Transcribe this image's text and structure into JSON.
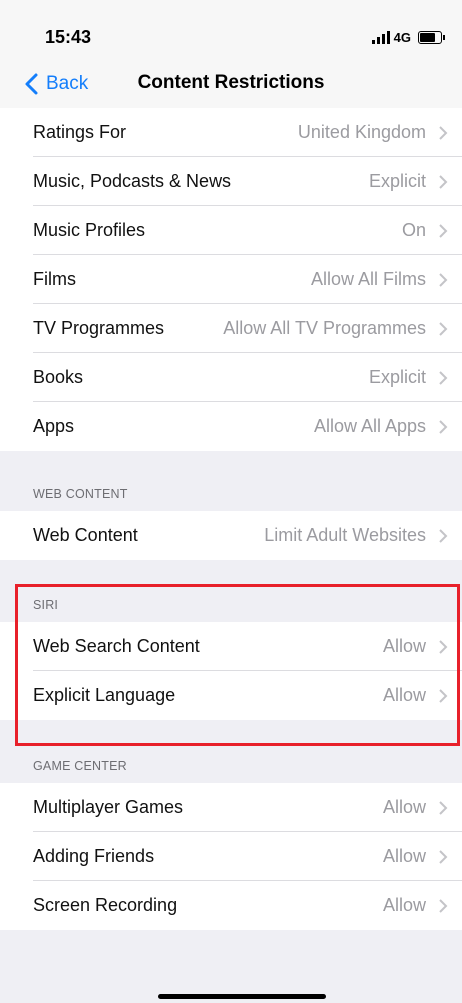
{
  "status_bar": {
    "time": "15:43",
    "network": "4G"
  },
  "nav": {
    "back_label": "Back",
    "title": "Content Restrictions"
  },
  "store_rows": [
    {
      "label": "Ratings For",
      "value": "United Kingdom"
    },
    {
      "label": "Music, Podcasts & News",
      "value": "Explicit"
    },
    {
      "label": "Music Profiles",
      "value": "On"
    },
    {
      "label": "Films",
      "value": "Allow All Films"
    },
    {
      "label": "TV Programmes",
      "value": "Allow All TV Programmes"
    },
    {
      "label": "Books",
      "value": "Explicit"
    },
    {
      "label": "Apps",
      "value": "Allow All Apps"
    }
  ],
  "web_content": {
    "header": "WEB CONTENT",
    "rows": [
      {
        "label": "Web Content",
        "value": "Limit Adult Websites"
      }
    ]
  },
  "siri": {
    "header": "SIRI",
    "rows": [
      {
        "label": "Web Search Content",
        "value": "Allow"
      },
      {
        "label": "Explicit Language",
        "value": "Allow"
      }
    ]
  },
  "game_center": {
    "header": "GAME CENTER",
    "rows": [
      {
        "label": "Multiplayer Games",
        "value": "Allow"
      },
      {
        "label": "Adding Friends",
        "value": "Allow"
      },
      {
        "label": "Screen Recording",
        "value": "Allow"
      }
    ]
  },
  "colors": {
    "accent": "#147efb",
    "highlight": "#e8202a"
  }
}
